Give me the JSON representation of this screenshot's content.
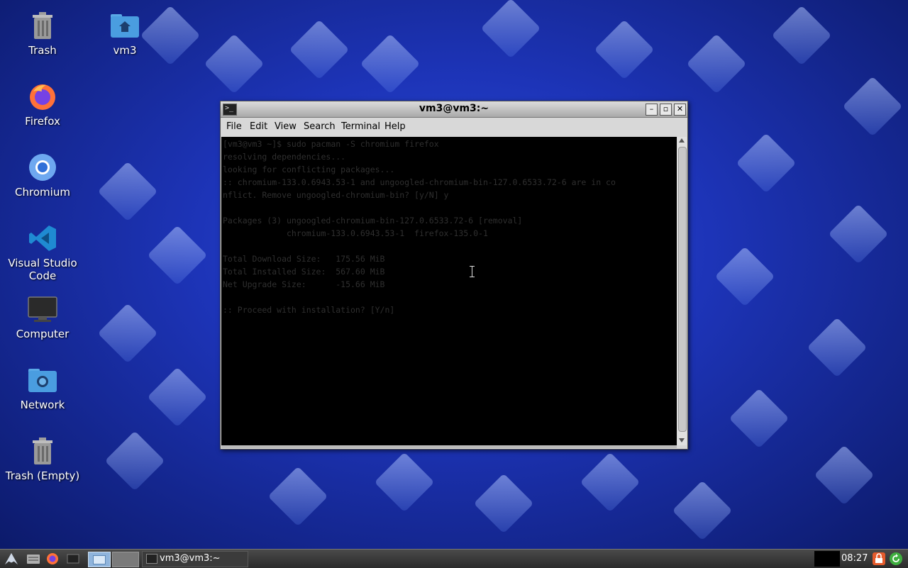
{
  "desktop_icons": [
    {
      "label": "Trash",
      "icon": "trash-icon"
    },
    {
      "label": "vm3",
      "icon": "home-folder-icon"
    },
    {
      "label": "Firefox",
      "icon": "firefox-icon"
    },
    {
      "label": "Chromium",
      "icon": "chromium-icon"
    },
    {
      "label": "Visual Studio Code",
      "icon": "vscode-icon"
    },
    {
      "label": "Computer",
      "icon": "computer-icon"
    },
    {
      "label": "Network",
      "icon": "network-folder-icon"
    },
    {
      "label": "Trash (Empty)",
      "icon": "trash-empty-icon"
    }
  ],
  "terminal_window": {
    "title": "vm3@vm3:~",
    "menu": [
      "File",
      "Edit",
      "View",
      "Search",
      "Terminal",
      "Help"
    ],
    "lines": [
      "[vm3@vm3 ~]$ sudo pacman -S chromium firefox",
      "resolving dependencies...",
      "looking for conflicting packages...",
      ":: chromium-133.0.6943.53-1 and ungoogled-chromium-bin-127.0.6533.72-6 are in co",
      "nflict. Remove ungoogled-chromium-bin? [y/N] y",
      "",
      "Packages (3) ungoogled-chromium-bin-127.0.6533.72-6 [removal]",
      "             chromium-133.0.6943.53-1  firefox-135.0-1",
      "",
      "Total Download Size:   175.56 MiB",
      "Total Installed Size:  567.60 MiB",
      "Net Upgrade Size:      -15.66 MiB",
      "",
      ":: Proceed with installation? [Y/n]"
    ]
  },
  "taskbar": {
    "task_label": "vm3@vm3:~",
    "clock": "08:27"
  },
  "colors": {
    "desktop_bg": "#1d34b8",
    "terminal_bg": "#000000",
    "terminal_text": "#2f2f2f",
    "taskbar_bg": "#2b2b2b"
  }
}
